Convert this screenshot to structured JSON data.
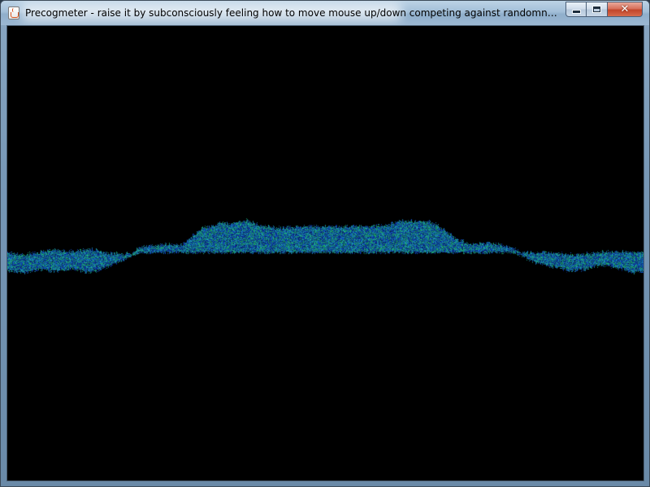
{
  "window": {
    "title": "Precogmeter - raise it by subconsciously feeling how to move mouse up/down competing against randomness (opensource free Java software by BenRayfield at HumanAI.net)",
    "controls": {
      "minimize": "minimize",
      "maximize": "maximize",
      "close": "close"
    },
    "app_icon": "java-cup-icon"
  },
  "visualization": {
    "background": "#000000",
    "palette": [
      "#0a3fb8",
      "#1463d9",
      "#1a86b8",
      "#18a98a",
      "#22c27a",
      "#1f9fc9",
      "#0d2f9a"
    ],
    "baseline_fraction": 0.5
  }
}
